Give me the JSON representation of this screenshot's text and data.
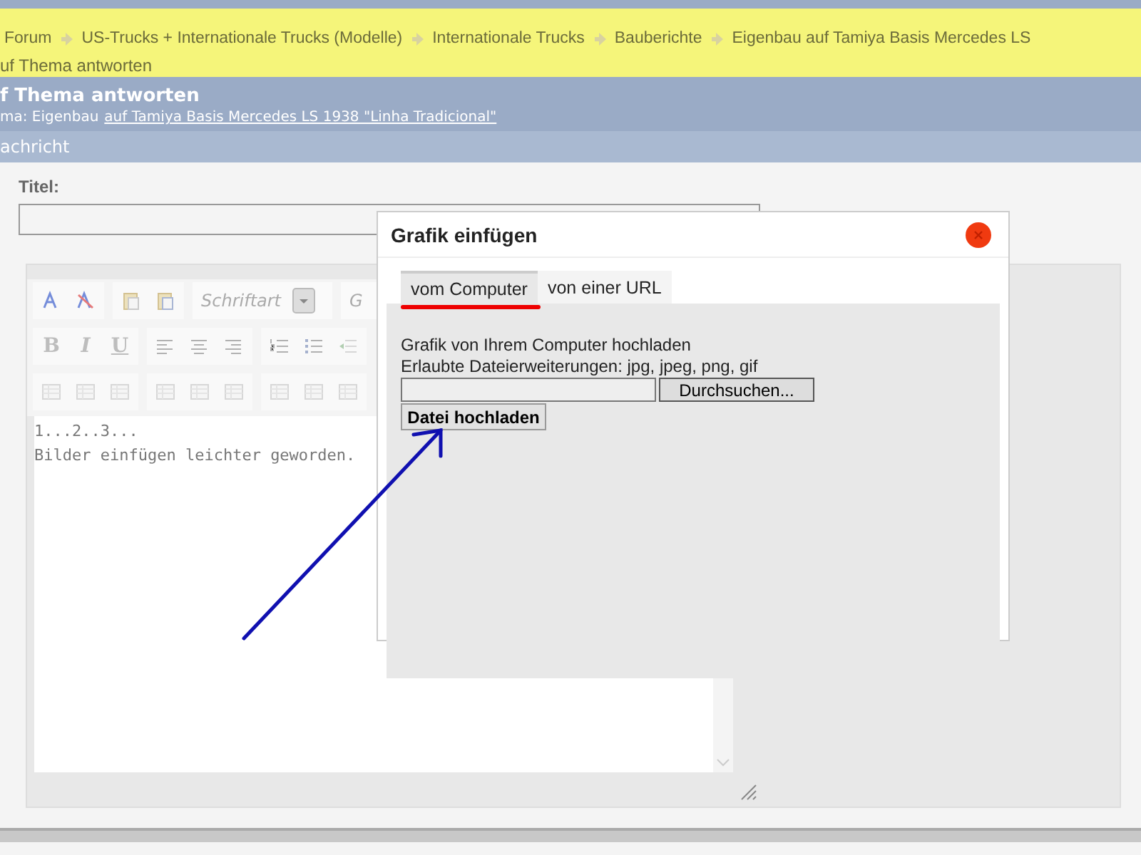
{
  "breadcrumb": {
    "items": [
      "Forum",
      "US-Trucks + Internationale Trucks (Modelle)",
      "Internationale Trucks",
      "Bauberichte",
      "Eigenbau auf Tamiya Basis Mercedes LS"
    ],
    "current": "uf Thema antworten"
  },
  "header": {
    "title": "f Thema antworten",
    "subtitle_prefix": "ma: Eigenbau",
    "subtitle_link": "auf Tamiya Basis Mercedes LS 1938 \"Linha Tradicional\""
  },
  "section_bar": {
    "label": "achricht"
  },
  "form": {
    "title_label": "Titel:",
    "font_select": "Schriftart",
    "size_select": "G",
    "toolbar_rows": [
      [
        "B",
        "I",
        "U"
      ]
    ],
    "editor_lines": [
      "1...2..3...",
      "Bilder einfügen leichter geworden."
    ]
  },
  "dialog": {
    "title": "Grafik einfügen",
    "tabs": [
      {
        "label": "vom Computer",
        "selected": true
      },
      {
        "label": "von einer URL",
        "selected": false
      }
    ],
    "lines": [
      "Grafik von Ihrem Computer hochladen",
      "Erlaubte Dateierweiterungen: jpg, jpeg, png, gif"
    ],
    "browse_button": "Durchsuchen...",
    "upload_button": "Datei hochladen"
  }
}
